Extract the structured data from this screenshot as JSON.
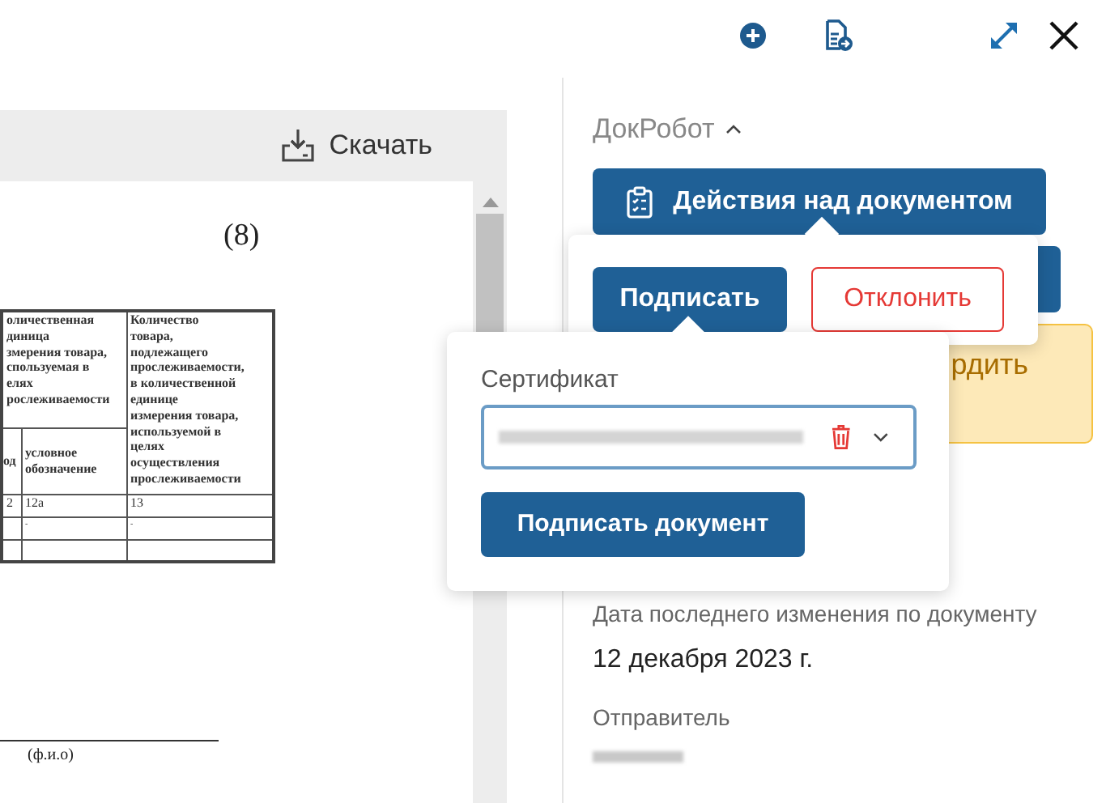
{
  "viewer": {
    "download_label": "Скачать",
    "page": {
      "number": "(8)",
      "table": {
        "header_top": [
          "оличественная\nдиница\nзмерения товара,\nспользуемая в\nелях\nрослеживаемости",
          "Количество\nтовара,\nподлежащего\nпрослеживаемости,\nв количественной\nединице\nизмерения товара,\nиспользуемой в\nцелях\nосуществления\nпрослеживаемости"
        ],
        "header_sub": [
          "од",
          "условное\nобозначение"
        ],
        "rows": [
          [
            "2",
            "12а",
            "13"
          ],
          [
            null,
            "-",
            "-"
          ],
          [
            null,
            null,
            null
          ]
        ]
      },
      "signature_caption": "(ф.и.о)"
    }
  },
  "panel": {
    "section_title": "ДокРобот",
    "expanded": true,
    "actions_button": "Действия над документом",
    "notice_text": "рдить",
    "fields": [
      {
        "label": "Дата последнего изменения по документу",
        "value": "12 декабря 2023 г."
      },
      {
        "label": "Отправитель"
      }
    ]
  },
  "actions_popup": {
    "buttons": [
      {
        "label": "Подписать",
        "kind": "primary",
        "selected": true
      },
      {
        "label": "Отклонить",
        "kind": "danger",
        "selected": false
      }
    ]
  },
  "sign_popup": {
    "certificate_label": "Сертификат",
    "submit": "Подписать документ"
  }
}
